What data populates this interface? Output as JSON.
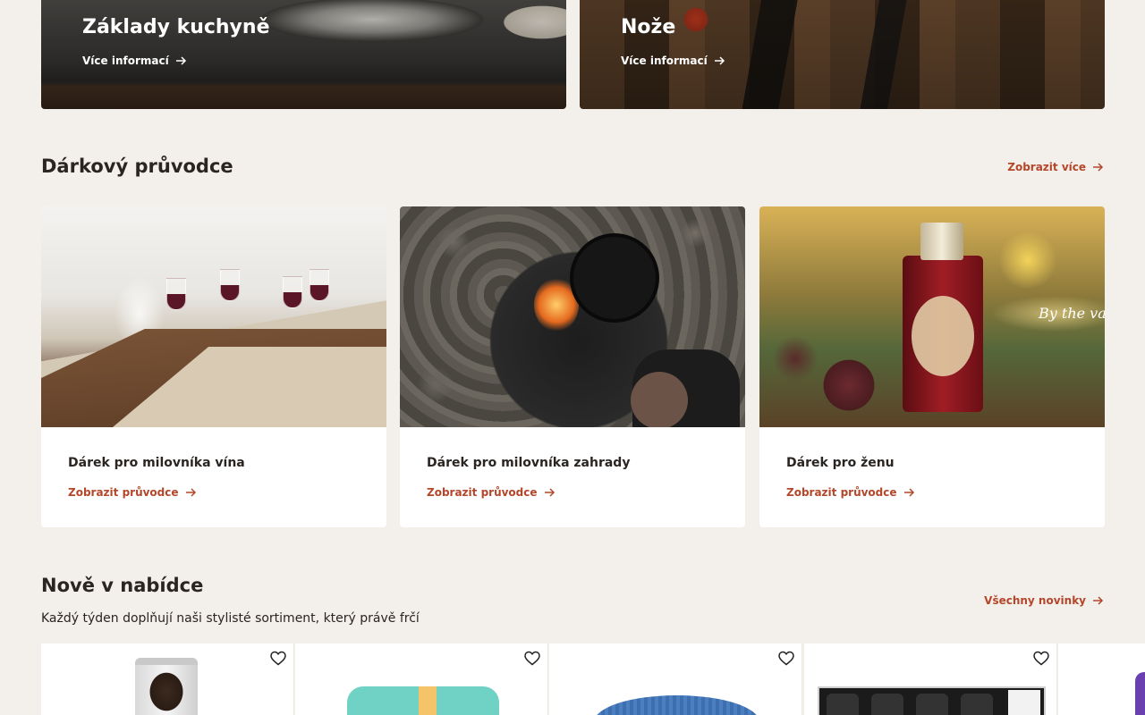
{
  "banners": [
    {
      "title": "Základy kuchyně",
      "link": "Více informací"
    },
    {
      "title": "Nože",
      "link": "Více informací"
    }
  ],
  "gift_guide": {
    "title": "Dárkový průvodce",
    "more_link": "Zobrazit více",
    "cards": [
      {
        "title": "Dárek pro milovníka vína",
        "link": "Zobrazit průvodce"
      },
      {
        "title": "Dárek pro milovníka zahrady",
        "link": "Zobrazit průvodce"
      },
      {
        "title": "Dárek pro ženu",
        "link": "Zobrazit průvodce",
        "image_text": "By the van"
      }
    ]
  },
  "new_arrivals": {
    "title": "Nově v nabídce",
    "subtitle": "Každý týden doplňují naši stylisté sortiment, který právě frčí",
    "all_link": "Všechny novinky"
  },
  "colors": {
    "page_bg": "#f3efeb",
    "accent": "#b4462a",
    "text": "#2b2521"
  },
  "icons": [
    "arrow-right-icon",
    "heart-icon"
  ]
}
